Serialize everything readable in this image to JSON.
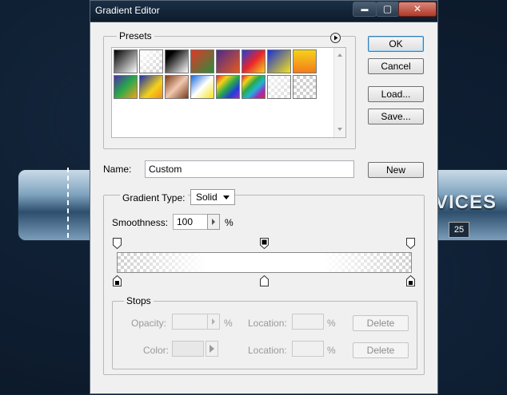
{
  "background": {
    "text": "VICES",
    "badge": "25"
  },
  "window": {
    "title": "Gradient Editor",
    "controls": {
      "minimize": "▬",
      "maximize": "▢",
      "close": "✕"
    }
  },
  "presets": {
    "label": "Presets",
    "menu_icon": "play-circle-icon",
    "swatches": [
      "linear-gradient(135deg,#000 0%,#fff 100%)",
      "checker-white",
      "linear-gradient(135deg,#000 20%,#fff 100%)",
      "linear-gradient(135deg,#e0382a 0%,#2e8b3c 100%)",
      "linear-gradient(135deg,#4b2a8c 0%,#e55a1f 100%)",
      "linear-gradient(135deg,#1f3fd8 0%,#e8242c 50%,#f5d21a 100%)",
      "linear-gradient(135deg,#1a2fd4 0%,#f3e31a 100%)",
      "linear-gradient(180deg,#f5d21a 0%,#f37b1a 100%)",
      "linear-gradient(135deg,#4a2fa8 0%,#2aa94a 50%,#f3a21a 100%)",
      "linear-gradient(135deg,#1b2fa8 0%,#f5d21a 60%,#f38a1a 100%)",
      "linear-gradient(135deg,#7b3a1a 0%,#f0c8b0 50%,#7b3a1a 100%)",
      "linear-gradient(135deg,#1a6ad8 0%,#fff 50%,#f3e31a 100%)",
      "linear-gradient(135deg,#e8242c,#f5d21a,#2aa94a,#1f3fd8,#a02ac0)",
      "linear-gradient(135deg,#e8242c,#f5d21a,#2aa94a,#1fb4d8,#a02ac0,#e8242c)",
      "checker-light",
      "checker"
    ]
  },
  "buttons": {
    "ok": "OK",
    "cancel": "Cancel",
    "load": "Load...",
    "save": "Save...",
    "new": "New",
    "delete_opacity": "Delete",
    "delete_color": "Delete"
  },
  "name": {
    "label": "Name:",
    "value": "Custom"
  },
  "gradient_type": {
    "label": "Gradient Type:",
    "value": "Solid"
  },
  "smoothness": {
    "label": "Smoothness:",
    "value": "100",
    "unit": "%"
  },
  "stops": {
    "label": "Stops",
    "opacity_label": "Opacity:",
    "opacity_unit": "%",
    "location_label": "Location:",
    "location_unit": "%",
    "color_label": "Color:"
  },
  "colors": {
    "window_bg": "#f0f0f0",
    "titlebar": "#0e1b2b",
    "default_button_border": "#3c7fb1"
  }
}
